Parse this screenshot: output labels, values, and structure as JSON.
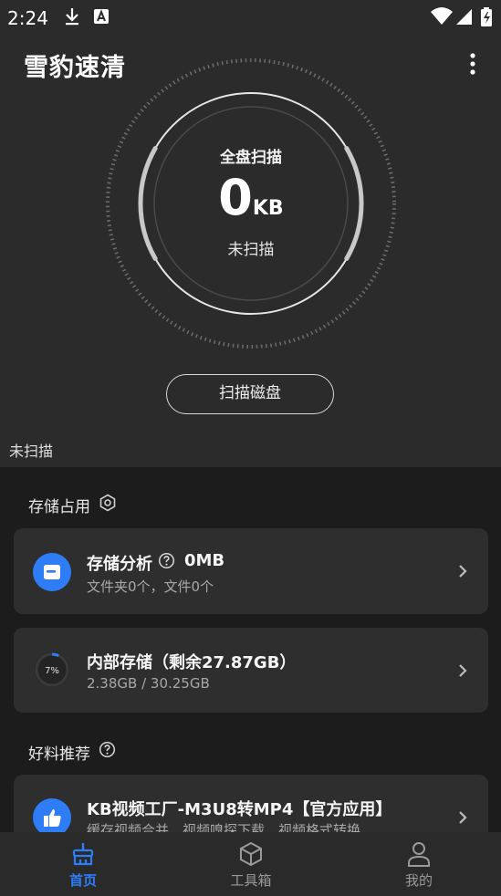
{
  "status_bar": {
    "time": "2:24"
  },
  "app": {
    "title": "雪豹速清"
  },
  "scan": {
    "title": "全盘扫描",
    "size_value": "0",
    "size_unit": "KB",
    "status": "未扫描",
    "button_label": "扫描磁盘",
    "hint": "未扫描"
  },
  "storage_section": {
    "title": "存储占用",
    "analysis": {
      "title": "存储分析",
      "value": "0MB",
      "subtitle": "文件夹0个，文件0个"
    },
    "internal": {
      "title": "内部存储（剩余27.87GB）",
      "subtitle": "2.38GB / 30.25GB",
      "percent_label": "7%",
      "percent": 7
    }
  },
  "recommend_section": {
    "title": "好料推荐",
    "item": {
      "title": "KB视频工厂-M3U8转MP4【官方应用】",
      "subtitle": "缓存视频合并，视频嗅探下载，视频格式转换"
    }
  },
  "nav": {
    "items": [
      {
        "label": "首页",
        "icon": "broom-icon",
        "active": true
      },
      {
        "label": "工具箱",
        "icon": "box-icon",
        "active": false
      },
      {
        "label": "我的",
        "icon": "person-icon",
        "active": false
      }
    ]
  },
  "colors": {
    "accent": "#2e7cf6",
    "background": "#2b2b2b",
    "content_bg": "#1c1c1c",
    "card_bg": "#2e2e2e"
  }
}
